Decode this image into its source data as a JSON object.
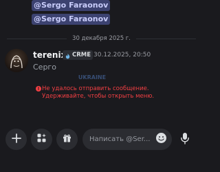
{
  "mentions": [
    "@Sergo Faraonov",
    "@Sergo Faraonov"
  ],
  "date_divider": "30 декабря 2025 г.",
  "message": {
    "author": "terenix",
    "tag": "CRME",
    "timestamp": "30.12.2025, 20:50",
    "text": "Серго",
    "error_icon_glyph": "!",
    "error": "Не удалось отправить сообщение. Удерживайте, чтобы открыть меню."
  },
  "watermark": "UKRAINE",
  "composer": {
    "placeholder": "Написать @Ser..."
  },
  "icons": {
    "add": "plus-icon",
    "apps": "apps-sparkle-icon",
    "gift": "gift-icon",
    "emoji": "emoji-smile-icon",
    "mic": "microphone-icon",
    "tag_badge": "flame-icon"
  },
  "colors": {
    "background": "#1a1a1e",
    "mention_bg": "#3c4270",
    "mention_fg": "#c9cdfb",
    "error": "#f23f43"
  }
}
